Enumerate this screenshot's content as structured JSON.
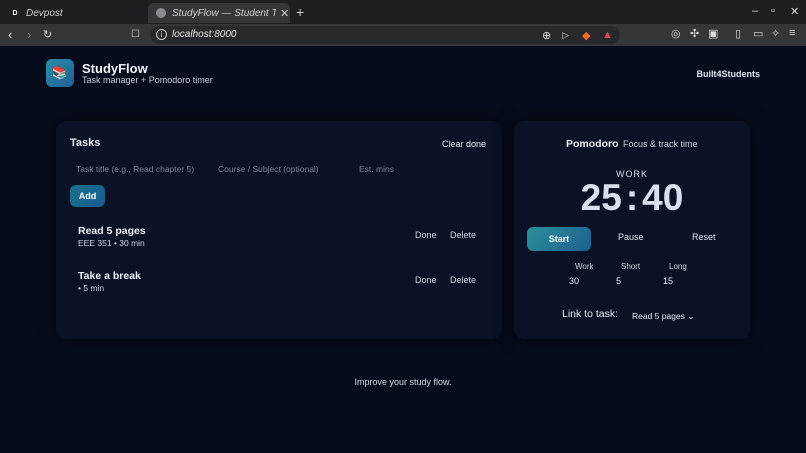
{
  "browser": {
    "tabs": [
      {
        "title": "Devpost",
        "favicon": "D"
      },
      {
        "title": "StudyFlow — Student Task",
        "close": "✕"
      }
    ],
    "new_tab": "+",
    "url": "localhost:8000",
    "window_controls": [
      "–",
      "▫",
      "✕"
    ]
  },
  "header": {
    "app_name": "StudyFlow",
    "tagline": "Task manager + Pomodoro timer",
    "link": "Built4Students",
    "logo_icon": "books-icon"
  },
  "tasks": {
    "title": "Tasks",
    "clear_done": "Clear done",
    "inputs": {
      "title_placeholder": "Task title (e.g., Read chapter 5)",
      "course_placeholder": "Course / Subject (optional)",
      "mins_placeholder": "Est. mins"
    },
    "add_label": "Add",
    "items": [
      {
        "name": "Read 5 pages",
        "meta": "EEE 351 • 30 min",
        "done": "Done",
        "delete": "Delete"
      },
      {
        "name": "Take a break",
        "meta": "• 5 min",
        "done": "Done",
        "delete": "Delete"
      }
    ]
  },
  "pomodoro": {
    "title": "Pomodoro",
    "subtitle": "Focus & track time",
    "mode": "WORK",
    "minutes": "25",
    "seconds": "40",
    "start": "Start",
    "pause": "Pause",
    "reset": "Reset",
    "durations": [
      {
        "label": "Work",
        "value": "30"
      },
      {
        "label": "Short",
        "value": "5"
      },
      {
        "label": "Long",
        "value": "15"
      }
    ],
    "link_label": "Link to task:",
    "link_value": "Read 5 pages"
  },
  "footer": "Improve your study flow.",
  "colors": {
    "background": "#070c1c",
    "card": "#0b1226",
    "accent": "#1e6f95"
  }
}
